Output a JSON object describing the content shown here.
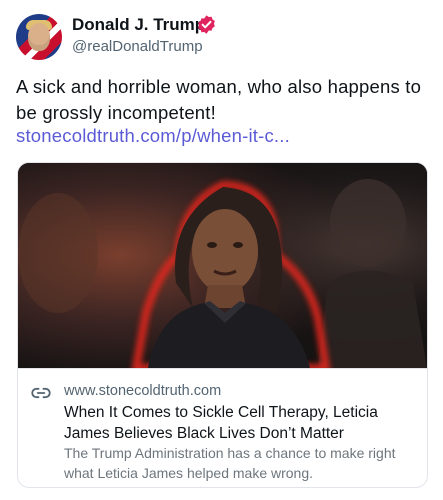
{
  "author": {
    "name": "Donald J. Trump",
    "handle": "@realDonaldTrump",
    "verified_color": "#e0245e"
  },
  "post": {
    "text": "A sick and horrible woman, who also happens to be grossly incompetent!",
    "link_text": "stonecoldtruth.com/p/when-it-c..."
  },
  "card": {
    "domain": "www.stonecoldtruth.com",
    "headline": "When It Comes to Sickle Cell Therapy, Leticia James Believes Black Lives Don’t Matter",
    "description": "The Trump Administration has a chance to make right what Leticia James helped make wrong.",
    "image_alt": "photo-collage-woman-red-glow",
    "link_icon": "link-icon"
  },
  "colors": {
    "link": "#5b5bd6",
    "secondary_text": "#536471",
    "border": "#e1e5ea",
    "image_glow": "#e0261c"
  }
}
